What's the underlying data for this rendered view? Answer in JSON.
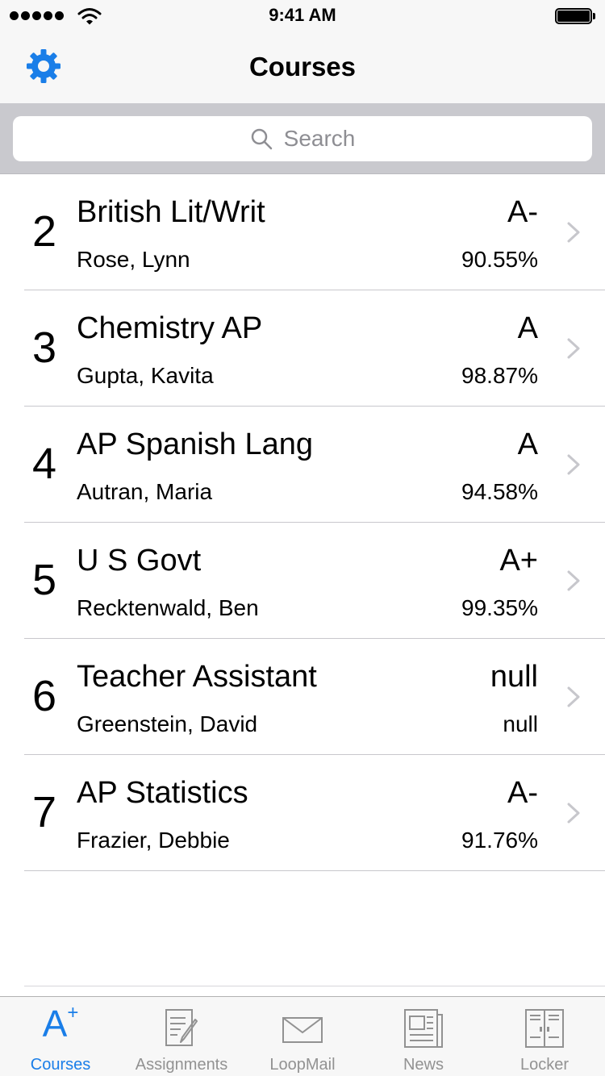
{
  "status_bar": {
    "time": "9:41 AM"
  },
  "nav": {
    "title": "Courses",
    "settings_icon": "gear-icon"
  },
  "search": {
    "placeholder": "Search"
  },
  "courses": [
    {
      "period": "2",
      "name": "British Lit/Writ",
      "teacher": "Rose, Lynn",
      "grade": "A-",
      "percent": "90.55%"
    },
    {
      "period": "3",
      "name": "Chemistry AP",
      "teacher": "Gupta, Kavita",
      "grade": "A",
      "percent": "98.87%"
    },
    {
      "period": "4",
      "name": "AP Spanish Lang",
      "teacher": "Autran, Maria",
      "grade": "A",
      "percent": "94.58%"
    },
    {
      "period": "5",
      "name": "U S Govt",
      "teacher": "Recktenwald, Ben",
      "grade": "A+",
      "percent": "99.35%"
    },
    {
      "period": "6",
      "name": "Teacher Assistant",
      "teacher": "Greenstein, David",
      "grade": "null",
      "percent": "null"
    },
    {
      "period": "7",
      "name": "AP Statistics",
      "teacher": "Frazier, Debbie",
      "grade": "A-",
      "percent": "91.76%"
    }
  ],
  "tabs": [
    {
      "label": "Courses",
      "icon": "a-plus-icon",
      "active": true,
      "icon_text": "A",
      "icon_sup": "+"
    },
    {
      "label": "Assignments",
      "icon": "assignments-icon"
    },
    {
      "label": "LoopMail",
      "icon": "mail-icon"
    },
    {
      "label": "News",
      "icon": "news-icon"
    },
    {
      "label": "Locker",
      "icon": "locker-icon"
    }
  ],
  "colors": {
    "accent": "#1a7ee8",
    "inactive": "#929292",
    "chevron": "#c7c7cc"
  }
}
